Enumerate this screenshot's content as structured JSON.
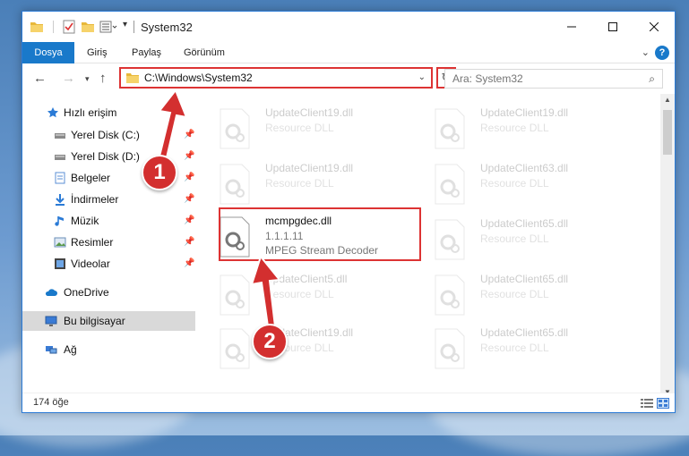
{
  "window": {
    "title": "System32"
  },
  "ribbon": {
    "tabs": [
      "Dosya",
      "Giriş",
      "Paylaş",
      "Görünüm"
    ],
    "help_label": "?"
  },
  "address": {
    "path": "C:\\Windows\\System32",
    "search_placeholder": "Ara: System32"
  },
  "nav": {
    "items": [
      {
        "label": "Hızlı erişim",
        "icon": "star-icon",
        "pinned": false
      },
      {
        "label": "Yerel Disk (C:)",
        "icon": "drive-icon",
        "pinned": true
      },
      {
        "label": "Yerel Disk (D:)",
        "icon": "drive-icon",
        "pinned": true
      },
      {
        "label": "Belgeler",
        "icon": "documents-icon",
        "pinned": true
      },
      {
        "label": "İndirmeler",
        "icon": "download-icon",
        "pinned": true
      },
      {
        "label": "Müzik",
        "icon": "music-icon",
        "pinned": true
      },
      {
        "label": "Resimler",
        "icon": "pictures-icon",
        "pinned": true
      },
      {
        "label": "Videolar",
        "icon": "video-icon",
        "pinned": true
      },
      {
        "label": "OneDrive",
        "icon": "cloud-icon",
        "pinned": false
      },
      {
        "label": "Bu bilgisayar",
        "icon": "computer-icon",
        "pinned": false,
        "selected": true
      },
      {
        "label": "Ağ",
        "icon": "network-icon",
        "pinned": false
      }
    ]
  },
  "files": {
    "left": [
      {
        "name": "UpdateClient19.dll",
        "desc": "Resource DLL"
      },
      {
        "name": "UpdateClient19.dll",
        "desc": "Resource DLL"
      },
      {
        "name": "mcmpgdec.dll",
        "version": "1.1.1.11",
        "desc": "MPEG Stream Decoder"
      },
      {
        "name": "UpdateClient5.dll",
        "desc": "Resource DLL"
      },
      {
        "name": "UpdateClient19.dll",
        "desc": "Resource DLL"
      }
    ],
    "right": [
      {
        "name": "UpdateClient19.dll",
        "desc": "Resource DLL"
      },
      {
        "name": "UpdateClient63.dll",
        "desc": "Resource DLL"
      },
      {
        "name": "UpdateClient65.dll",
        "desc": "Resource DLL"
      },
      {
        "name": "UpdateClient65.dll",
        "desc": "Resource DLL"
      },
      {
        "name": "UpdateClient65.dll",
        "desc": "Resource DLL"
      }
    ]
  },
  "status": {
    "count": "174 öğe"
  },
  "annotations": {
    "badge1": "1",
    "badge2": "2",
    "color": "#d32f2f"
  }
}
